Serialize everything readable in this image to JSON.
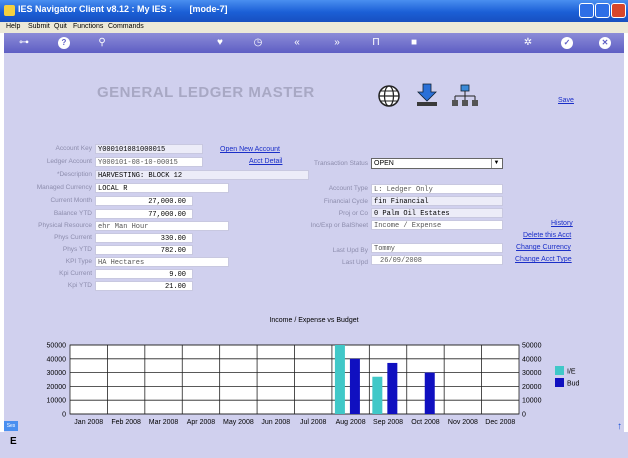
{
  "window": {
    "title": "IES Navigator Client v8.12 : My IES :       [mode-7]"
  },
  "menu": [
    "Help",
    "Submit",
    "Quit",
    "Functions",
    "Commands"
  ],
  "toolbar_icons": [
    "key-icon",
    "help-icon",
    "search-icon",
    "heart-icon",
    "clock-icon",
    "back-icon",
    "forward-icon",
    "column-icon",
    "stop-icon",
    "gear-icon",
    "check-icon",
    "close-icon"
  ],
  "page": {
    "title": "GENERAL LEDGER MASTER",
    "save": "Save"
  },
  "left_fields": [
    {
      "label": "Account Key",
      "value": "Y000101081000015"
    },
    {
      "label": "Ledger Account",
      "value": "Y000101-08-10-00015"
    },
    {
      "label": "*Description",
      "value": "HARVESTING: BLOCK 12"
    },
    {
      "label": "Managed Currency",
      "value": "LOCAL R"
    },
    {
      "label": "Current Month",
      "value": "27,000.00"
    },
    {
      "label": "Balance YTD",
      "value": "77,000.00"
    },
    {
      "label": "Physical Resource",
      "value": "ehr Man Hour"
    },
    {
      "label": "Phys Current",
      "value": "330.00"
    },
    {
      "label": "Phys YTD",
      "value": "782.00"
    },
    {
      "label": "KPI Type",
      "value": "HA Hectares"
    },
    {
      "label": "Kpi Current",
      "value": "9.00"
    },
    {
      "label": "Kpi YTD",
      "value": "21.00"
    }
  ],
  "links": {
    "open_new": "Open New Account",
    "acct_detail": "Acct Detail",
    "history": "History",
    "delete": "Delete this Acct",
    "change_currency": "Change Currency",
    "change_type": "Change Acct Type"
  },
  "transaction_status": {
    "label": "Transaction Status",
    "value": "OPEN"
  },
  "right_fields": [
    {
      "label": "Account Type",
      "value": "L: Ledger Only"
    },
    {
      "label": "Financial Cycle",
      "value": "fin Financial"
    },
    {
      "label": "Proj or Co",
      "value": "0 Palm Oil Estates"
    },
    {
      "label": "Inc/Exp or BalSheet",
      "value": "Income / Expense"
    }
  ],
  "last_fields": [
    {
      "label": "Last Upd By",
      "value": "Tommy"
    },
    {
      "label": "Last Upd",
      "value": "26/09/2008"
    }
  ],
  "chart_data": {
    "type": "bar",
    "title": "Income / Expense vs Budget",
    "categories": [
      "Jan 2008",
      "Feb 2008",
      "Mar 2008",
      "Apr 2008",
      "May 2008",
      "Jun 2008",
      "Jul 2008",
      "Aug 2008",
      "Sep 2008",
      "Oct 2008",
      "Nov 2008",
      "Dec 2008"
    ],
    "series": [
      {
        "name": "I/E",
        "color": "#40c8c8",
        "values": [
          0,
          0,
          0,
          0,
          0,
          0,
          0,
          50000,
          27000,
          0,
          0,
          0
        ]
      },
      {
        "name": "Bud",
        "color": "#1010c0",
        "values": [
          0,
          0,
          0,
          0,
          0,
          0,
          0,
          40000,
          37000,
          30000,
          0,
          0
        ]
      }
    ],
    "y_ticks": [
      "50000",
      "40000",
      "30000",
      "20000",
      "10000",
      "0"
    ],
    "ylim": [
      0,
      50000
    ],
    "grid": true,
    "legend": "right"
  },
  "status": {
    "left": "Ses",
    "letter": "E"
  }
}
